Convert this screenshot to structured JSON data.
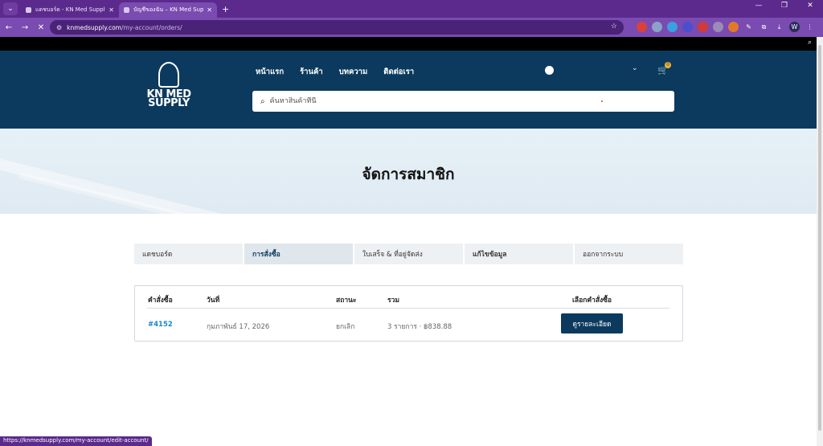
{
  "browser": {
    "tabs": [
      {
        "title": "แดชบอร์ด - KN Med Supply — ...",
        "active": false
      },
      {
        "title": "บัญชีของฉัน – KN Med Supply",
        "active": true
      }
    ],
    "url_host": "knmedsupply.com",
    "url_path": "/my-account/orders/",
    "new_tab_symbol": "+",
    "status_url": "https://knmedsupply.com/my-account/edit-account/"
  },
  "site": {
    "logo_line1": "KN MED",
    "logo_line2": "SUPPLY",
    "nav": [
      "หน้าแรก",
      "ร้านค้า",
      "บทความ",
      "ติดต่อเรา"
    ],
    "cart_count": "0",
    "search_placeholder": "ค้นหาสินค้าที่นี่"
  },
  "hero": {
    "title": "จัดการสมาชิก"
  },
  "account_tabs": [
    {
      "label": "แดชบอร์ด",
      "active": false
    },
    {
      "label": "การสั่งซื้อ",
      "active": true
    },
    {
      "label": "ใบเสร็จ & ที่อยู่จัดส่ง",
      "active": false
    },
    {
      "label": "แก้ไขข้อมูล",
      "active": false
    },
    {
      "label": "ออกจากระบบ",
      "active": false
    }
  ],
  "orders": {
    "headers": {
      "order": "คำสั่งซื้อ",
      "date": "วันที่",
      "status": "สถานะ",
      "total": "รวม",
      "actions": "เลือกคำสั่งซื้อ"
    },
    "rows": [
      {
        "order": "#4152",
        "date": "กุมภาพันธ์ 17, 2026",
        "status": "ยกเลิก",
        "total": "3 รายการ · ฿838.88",
        "action": "ดูรายละเอียด"
      }
    ]
  },
  "colors": {
    "header_bg": "#0c3a5e",
    "browser_frame": "#7a4bb0",
    "link": "#1a87c9"
  }
}
